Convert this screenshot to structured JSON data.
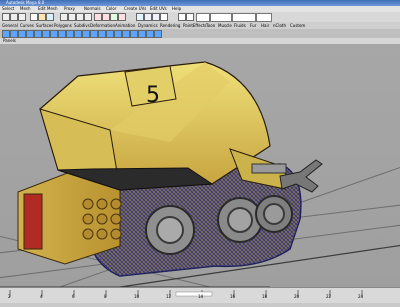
{
  "window": {
    "title": "Autodesk Maya 8.0"
  },
  "menu": [
    "Select",
    "Mesh",
    "Edit Mesh",
    "Proxy",
    "Normals",
    "Color",
    "Create UVs",
    "Edit UVs",
    "Help"
  ],
  "tabs": [
    "General",
    "Curves",
    "Surfaces",
    "Polygons",
    "Subdivs",
    "Deformation",
    "Animation",
    "Dynamics",
    "Rendering",
    "PaintEffects",
    "Toon",
    "Muscle",
    "Fluids",
    "Fur",
    "Hair",
    "nCloth",
    "Custom"
  ],
  "panel_menu": "Panels",
  "timeline": {
    "ticks": [
      "2",
      "4",
      "6",
      "8",
      "10",
      "12",
      "14",
      "16",
      "18",
      "20",
      "22",
      "24"
    ]
  },
  "model": {
    "decal": "5"
  }
}
